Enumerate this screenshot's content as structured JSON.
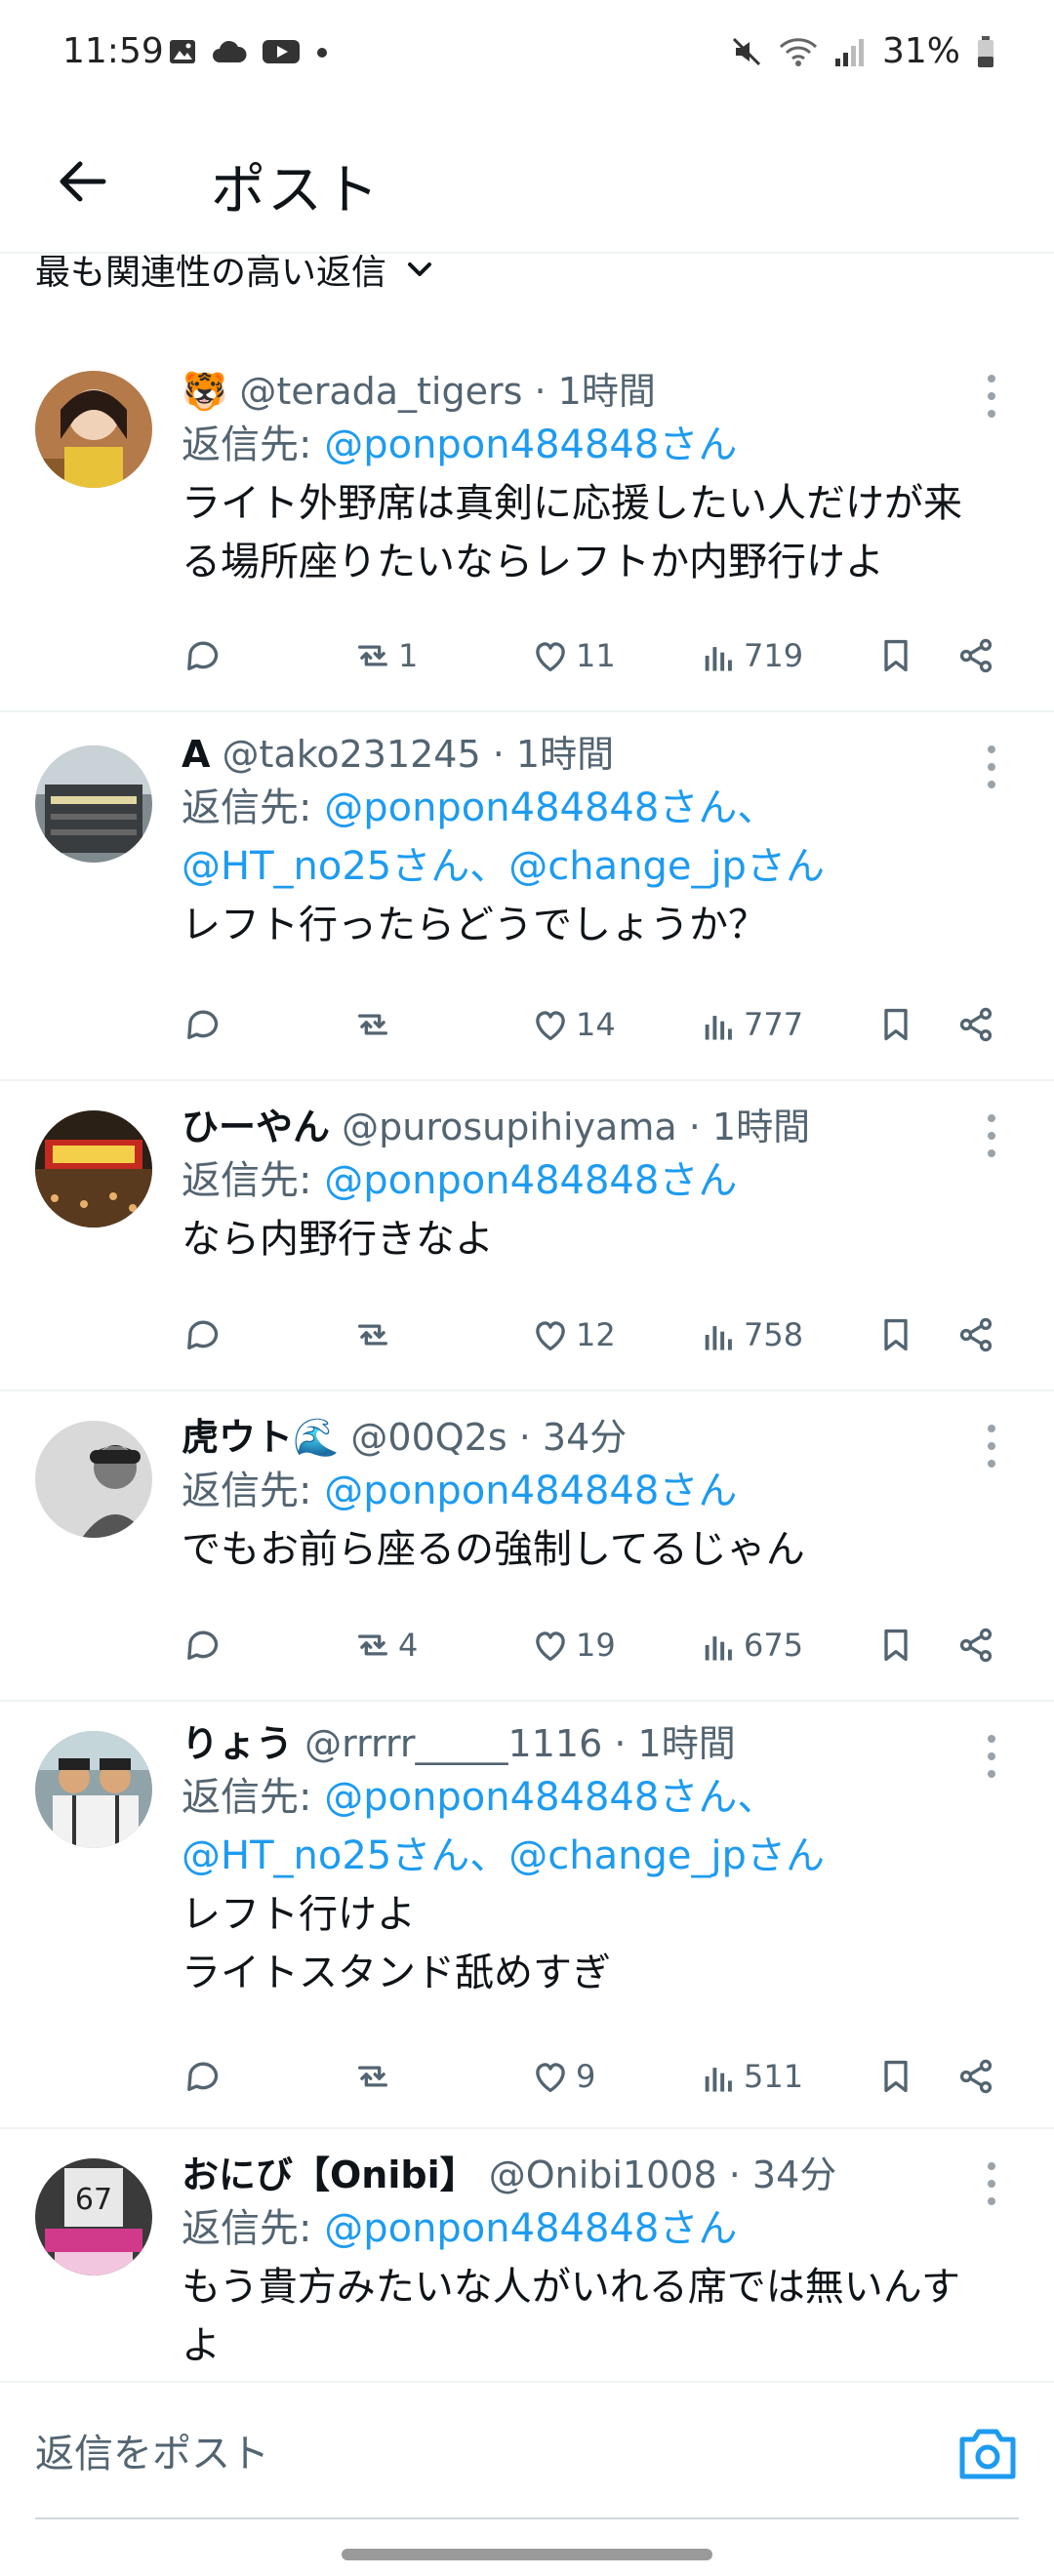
{
  "status_bar": {
    "time": "11:59",
    "battery": "31%"
  },
  "header": {
    "back_icon": "arrow-left-icon",
    "title": "ポスト"
  },
  "sort": {
    "label": "最も関連性の高い返信"
  },
  "replies": [
    {
      "name": "🐯",
      "handle": "@terada_tigers",
      "time": "· 1時間",
      "reply_label": "返信先: ",
      "reply_to_1": "@ponpon484848さん",
      "reply_to_2": "",
      "text": "ライト外野席は真剣に応援したい人だけが来る場所座りたいならレフトか内野行けよ",
      "retweets": "1",
      "likes": "11",
      "views": "719"
    },
    {
      "name": "A",
      "handle": "@tako231245",
      "time": "· 1時間",
      "reply_label": "返信先: ",
      "reply_to_1": "@ponpon484848さん、",
      "reply_to_2": "@HT_no25さん、@change_jpさん",
      "text": "レフト行ったらどうでしょうか？",
      "retweets": "",
      "likes": "14",
      "views": "777"
    },
    {
      "name": "ひーやん",
      "handle": "@purosupihiyama",
      "time": "· 1時間",
      "reply_label": "返信先: ",
      "reply_to_1": "@ponpon484848さん",
      "reply_to_2": "",
      "text": "なら内野行きなよ",
      "retweets": "",
      "likes": "12",
      "views": "758"
    },
    {
      "name": "虎ウト🌊",
      "handle": "@00Q2s",
      "time": "· 34分",
      "reply_label": "返信先: ",
      "reply_to_1": "@ponpon484848さん",
      "reply_to_2": "",
      "text": "でもお前ら座るの強制してるじゃん",
      "retweets": "4",
      "likes": "19",
      "views": "675"
    },
    {
      "name": "りょう",
      "handle": "@rrrrr_____1116",
      "time": "· 1時間",
      "reply_label": "返信先: ",
      "reply_to_1": "@ponpon484848さん、",
      "reply_to_2": "@HT_no25さん、@change_jpさん",
      "text": "レフト行けよ\nライトスタンド舐めすぎ",
      "retweets": "",
      "likes": "9",
      "views": "511"
    },
    {
      "name": "おにび【Onibi】",
      "handle": "@Onibi1008",
      "time": "· 34分",
      "reply_label": "返信先: ",
      "reply_to_1": "@ponpon484848さん",
      "reply_to_2": "",
      "text": "もう貴方みたいな人がいれる席では無いんすよ",
      "retweets": "",
      "likes": "",
      "views": ""
    }
  ],
  "composer": {
    "placeholder": "返信をポスト",
    "camera_icon": "camera-icon"
  },
  "colors": {
    "accent": "#1d9bf0",
    "muted": "#536471",
    "text": "#0f1419",
    "divider": "#eff3f4"
  }
}
